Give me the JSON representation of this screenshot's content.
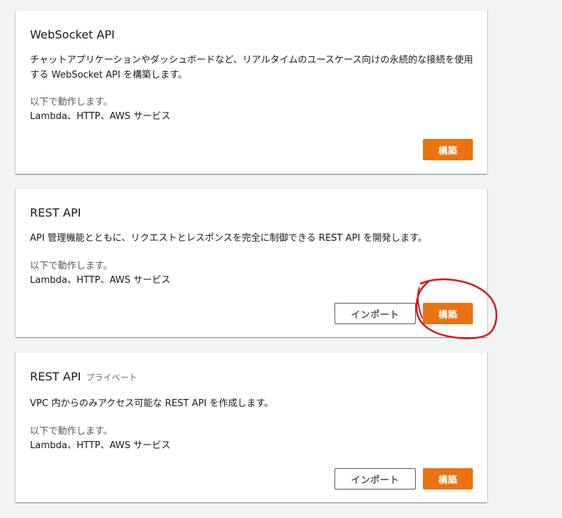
{
  "cards": [
    {
      "title": "WebSocket API",
      "title_suffix": "",
      "description": "チャットアプリケーションやダッシュボードなど、リアルタイムのユースケース向けの永続的な接続を使用する WebSocket API を構築します。",
      "works_with_label": "以下で動作します。",
      "works_with_values": "Lambda、HTTP、AWS サービス",
      "buttons": {
        "build": "構築"
      }
    },
    {
      "title": "REST API",
      "title_suffix": "",
      "description": "API 管理機能とともに、リクエストとレスポンスを完全に制御できる REST API を開発します。",
      "works_with_label": "以下で動作します。",
      "works_with_values": "Lambda、HTTP、AWS サービス",
      "buttons": {
        "import": "インポート",
        "build": "構築"
      }
    },
    {
      "title": "REST API",
      "title_suffix": "プライベート",
      "description": "VPC 内からのみアクセス可能な REST API を作成します。",
      "works_with_label": "以下で動作します。",
      "works_with_values": "Lambda、HTTP、AWS サービス",
      "buttons": {
        "import": "インポート",
        "build": "構築"
      }
    }
  ],
  "colors": {
    "page_background": "#f2f3f3",
    "primary_button": "#ec7211",
    "annotation": "#e0121b"
  }
}
